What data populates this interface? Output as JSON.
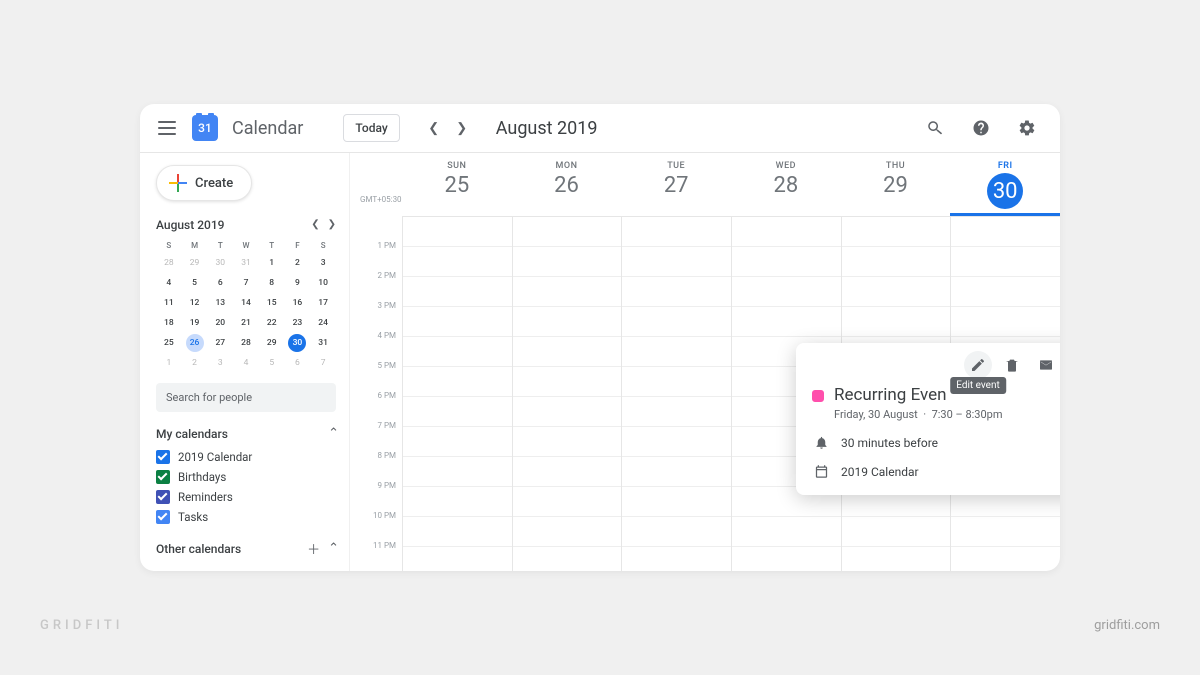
{
  "watermark": {
    "left": "GRIDFITI",
    "right": "gridfiti.com"
  },
  "header": {
    "logo_day": "31",
    "app_name": "Calendar",
    "today": "Today",
    "month_title": "August 2019"
  },
  "sidebar": {
    "create": "Create",
    "mini": {
      "title": "August 2019",
      "dow": [
        "S",
        "M",
        "T",
        "W",
        "T",
        "F",
        "S"
      ],
      "rows": [
        [
          {
            "d": "28",
            "o": true
          },
          {
            "d": "29",
            "o": true
          },
          {
            "d": "30",
            "o": true
          },
          {
            "d": "31",
            "o": true
          },
          {
            "d": "1"
          },
          {
            "d": "2"
          },
          {
            "d": "3"
          }
        ],
        [
          {
            "d": "4"
          },
          {
            "d": "5"
          },
          {
            "d": "6"
          },
          {
            "d": "7"
          },
          {
            "d": "8"
          },
          {
            "d": "9"
          },
          {
            "d": "10"
          }
        ],
        [
          {
            "d": "11"
          },
          {
            "d": "12"
          },
          {
            "d": "13"
          },
          {
            "d": "14"
          },
          {
            "d": "15"
          },
          {
            "d": "16"
          },
          {
            "d": "17"
          }
        ],
        [
          {
            "d": "18"
          },
          {
            "d": "19"
          },
          {
            "d": "20"
          },
          {
            "d": "21"
          },
          {
            "d": "22"
          },
          {
            "d": "23"
          },
          {
            "d": "24"
          }
        ],
        [
          {
            "d": "25"
          },
          {
            "d": "26",
            "sel": true
          },
          {
            "d": "27"
          },
          {
            "d": "28"
          },
          {
            "d": "29"
          },
          {
            "d": "30",
            "today": true
          },
          {
            "d": "31"
          }
        ],
        [
          {
            "d": "1",
            "o": true
          },
          {
            "d": "2",
            "o": true
          },
          {
            "d": "3",
            "o": true
          },
          {
            "d": "4",
            "o": true
          },
          {
            "d": "5",
            "o": true
          },
          {
            "d": "6",
            "o": true
          },
          {
            "d": "7",
            "o": true
          }
        ]
      ]
    },
    "search_placeholder": "Search for people",
    "my_calendars": {
      "title": "My calendars",
      "items": [
        {
          "label": "2019 Calendar",
          "color": "cb-blue"
        },
        {
          "label": "Birthdays",
          "color": "cb-green"
        },
        {
          "label": "Reminders",
          "color": "cb-indigo"
        },
        {
          "label": "Tasks",
          "color": "cb-lightblue"
        }
      ]
    },
    "other_calendars": {
      "title": "Other calendars"
    }
  },
  "main": {
    "timezone": "GMT+05:30",
    "days": [
      {
        "dow": "SUN",
        "num": "25"
      },
      {
        "dow": "MON",
        "num": "26"
      },
      {
        "dow": "TUE",
        "num": "27"
      },
      {
        "dow": "WED",
        "num": "28"
      },
      {
        "dow": "THU",
        "num": "29"
      },
      {
        "dow": "FRI",
        "num": "30",
        "current": true
      }
    ],
    "hours": [
      "",
      "1 PM",
      "2 PM",
      "3 PM",
      "4 PM",
      "5 PM",
      "6 PM",
      "7 PM",
      "8 PM",
      "9 PM",
      "10 PM",
      "11 PM"
    ]
  },
  "event": {
    "title": "Recurring Event",
    "time": "7:30 – 8:30pm"
  },
  "popup": {
    "tooltip": "Edit event",
    "title": "Recurring Even",
    "date": "Friday, 30 August",
    "sep": "·",
    "time": "7:30 – 8:30pm",
    "reminder": "30 minutes before",
    "calendar": "2019 Calendar"
  }
}
